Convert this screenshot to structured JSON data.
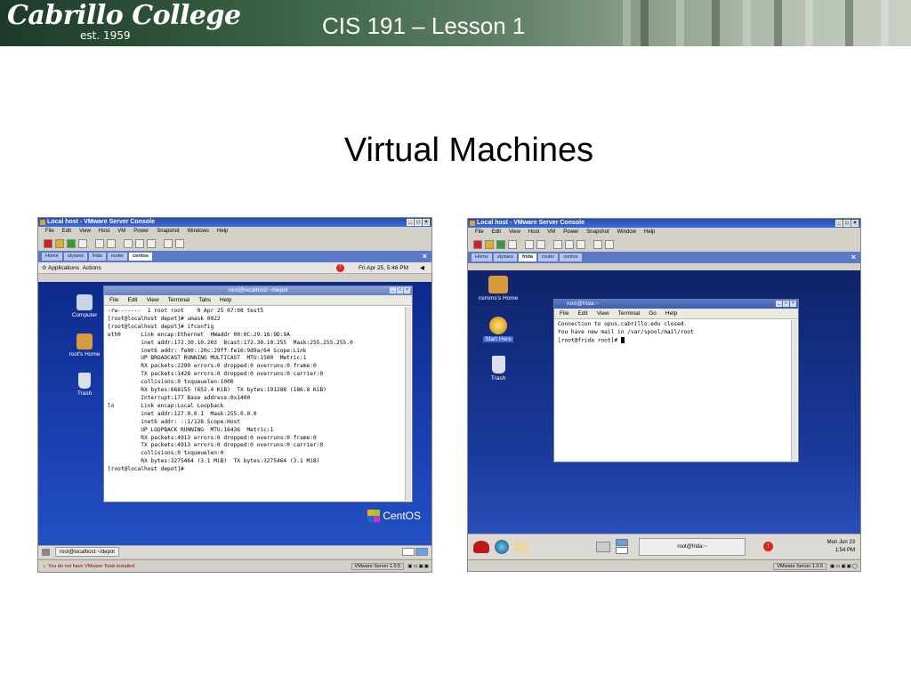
{
  "header": {
    "logo": "Cabrillo College",
    "logo_sub": "est. 1959",
    "course": "CIS 191 – Lesson 1"
  },
  "slide_title": "Virtual Machines",
  "left": {
    "window_title": "Local host - VMware Server Console",
    "menu": [
      "File",
      "Edit",
      "View",
      "Host",
      "VM",
      "Power",
      "Snapshot",
      "Windows",
      "Help"
    ],
    "tabs": [
      "Home",
      "ulysses",
      "frida",
      "router",
      "centos"
    ],
    "active_tab": "centos",
    "gnome_menu": [
      "Applications",
      "Actions"
    ],
    "clock": "Fri Apr 25,  5:46 PM",
    "desktop_icons": [
      "Computer",
      "root's Home",
      "Trash"
    ],
    "terminal_title": "root@localhost:~/depot",
    "terminal_menu": [
      "File",
      "Edit",
      "View",
      "Terminal",
      "Tabs",
      "Help"
    ],
    "terminal_lines": [
      "-rw-------  1 root root    0 Apr 25 07:08 test5",
      "[root@localhost depot]# umask 0022",
      "[root@localhost depot]# ifconfig",
      "eth0      Link encap:Ethernet  HWaddr 00:0C:29:16:9D:9A",
      "          inet addr:172.30.10.203  Bcast:172.30.10.255  Mask:255.255.255.0",
      "          inet6 addr: fe80::20c:29ff:fe16:9d9a/64 Scope:Link",
      "          UP BROADCAST RUNNING MULTICAST  MTU:1500  Metric:1",
      "          RX packets:2290 errors:0 dropped:0 overruns:0 frame:0",
      "          TX packets:1428 errors:0 dropped:0 overruns:0 carrier:0",
      "          collisions:0 txqueuelen:1000",
      "          RX bytes:668155 (652.4 KiB)  TX bytes:191288 (186.8 KiB)",
      "          Interrupt:177 Base address:0x1400",
      "",
      "lo        Link encap:Local Loopback",
      "          inet addr:127.0.0.1  Mask:255.0.0.0",
      "          inet6 addr: ::1/128 Scope:Host",
      "          UP LOOPBACK RUNNING  MTU:16436  Metric:1",
      "          RX packets:4913 errors:0 dropped:0 overruns:0 frame:0",
      "          TX packets:4913 errors:0 dropped:0 overruns:0 carrier:0",
      "          collisions:0 txqueuelen:0",
      "          RX bytes:3275464 (3.1 MiB)  TX bytes:3275464 (3.1 MiB)",
      "",
      "[root@localhost depot]#"
    ],
    "brand": "CentOS",
    "taskbar_item": "root@localhost:~/depot",
    "status_warning": "You do not have VMware Tools installed.",
    "status_version": "VMware Server 1.0.5"
  },
  "right": {
    "window_title": "Local host - VMware Server Console",
    "menu": [
      "File",
      "Edit",
      "View",
      "Host",
      "VM",
      "Power",
      "Snapshot",
      "Window",
      "Help"
    ],
    "tabs": [
      "Home",
      "ulysses",
      "frida",
      "router",
      "centos"
    ],
    "active_tab": "frida",
    "desktop_icons": [
      "rsimms's Home",
      "Start Here",
      "Trash"
    ],
    "terminal_title": "root@frida:~",
    "terminal_menu": [
      "File",
      "Edit",
      "View",
      "Terminal",
      "Go",
      "Help"
    ],
    "terminal_lines": [
      "Connection to opus.cabrillo.edu closed.",
      "You have new mail in /var/spool/mail/root",
      "[root@frida root]# "
    ],
    "taskbar_item": "root@frida:~",
    "clock_date": "Mon Jun 23",
    "clock_time": "1:54 PM",
    "status_version": "VMware Server 1.0.5"
  }
}
